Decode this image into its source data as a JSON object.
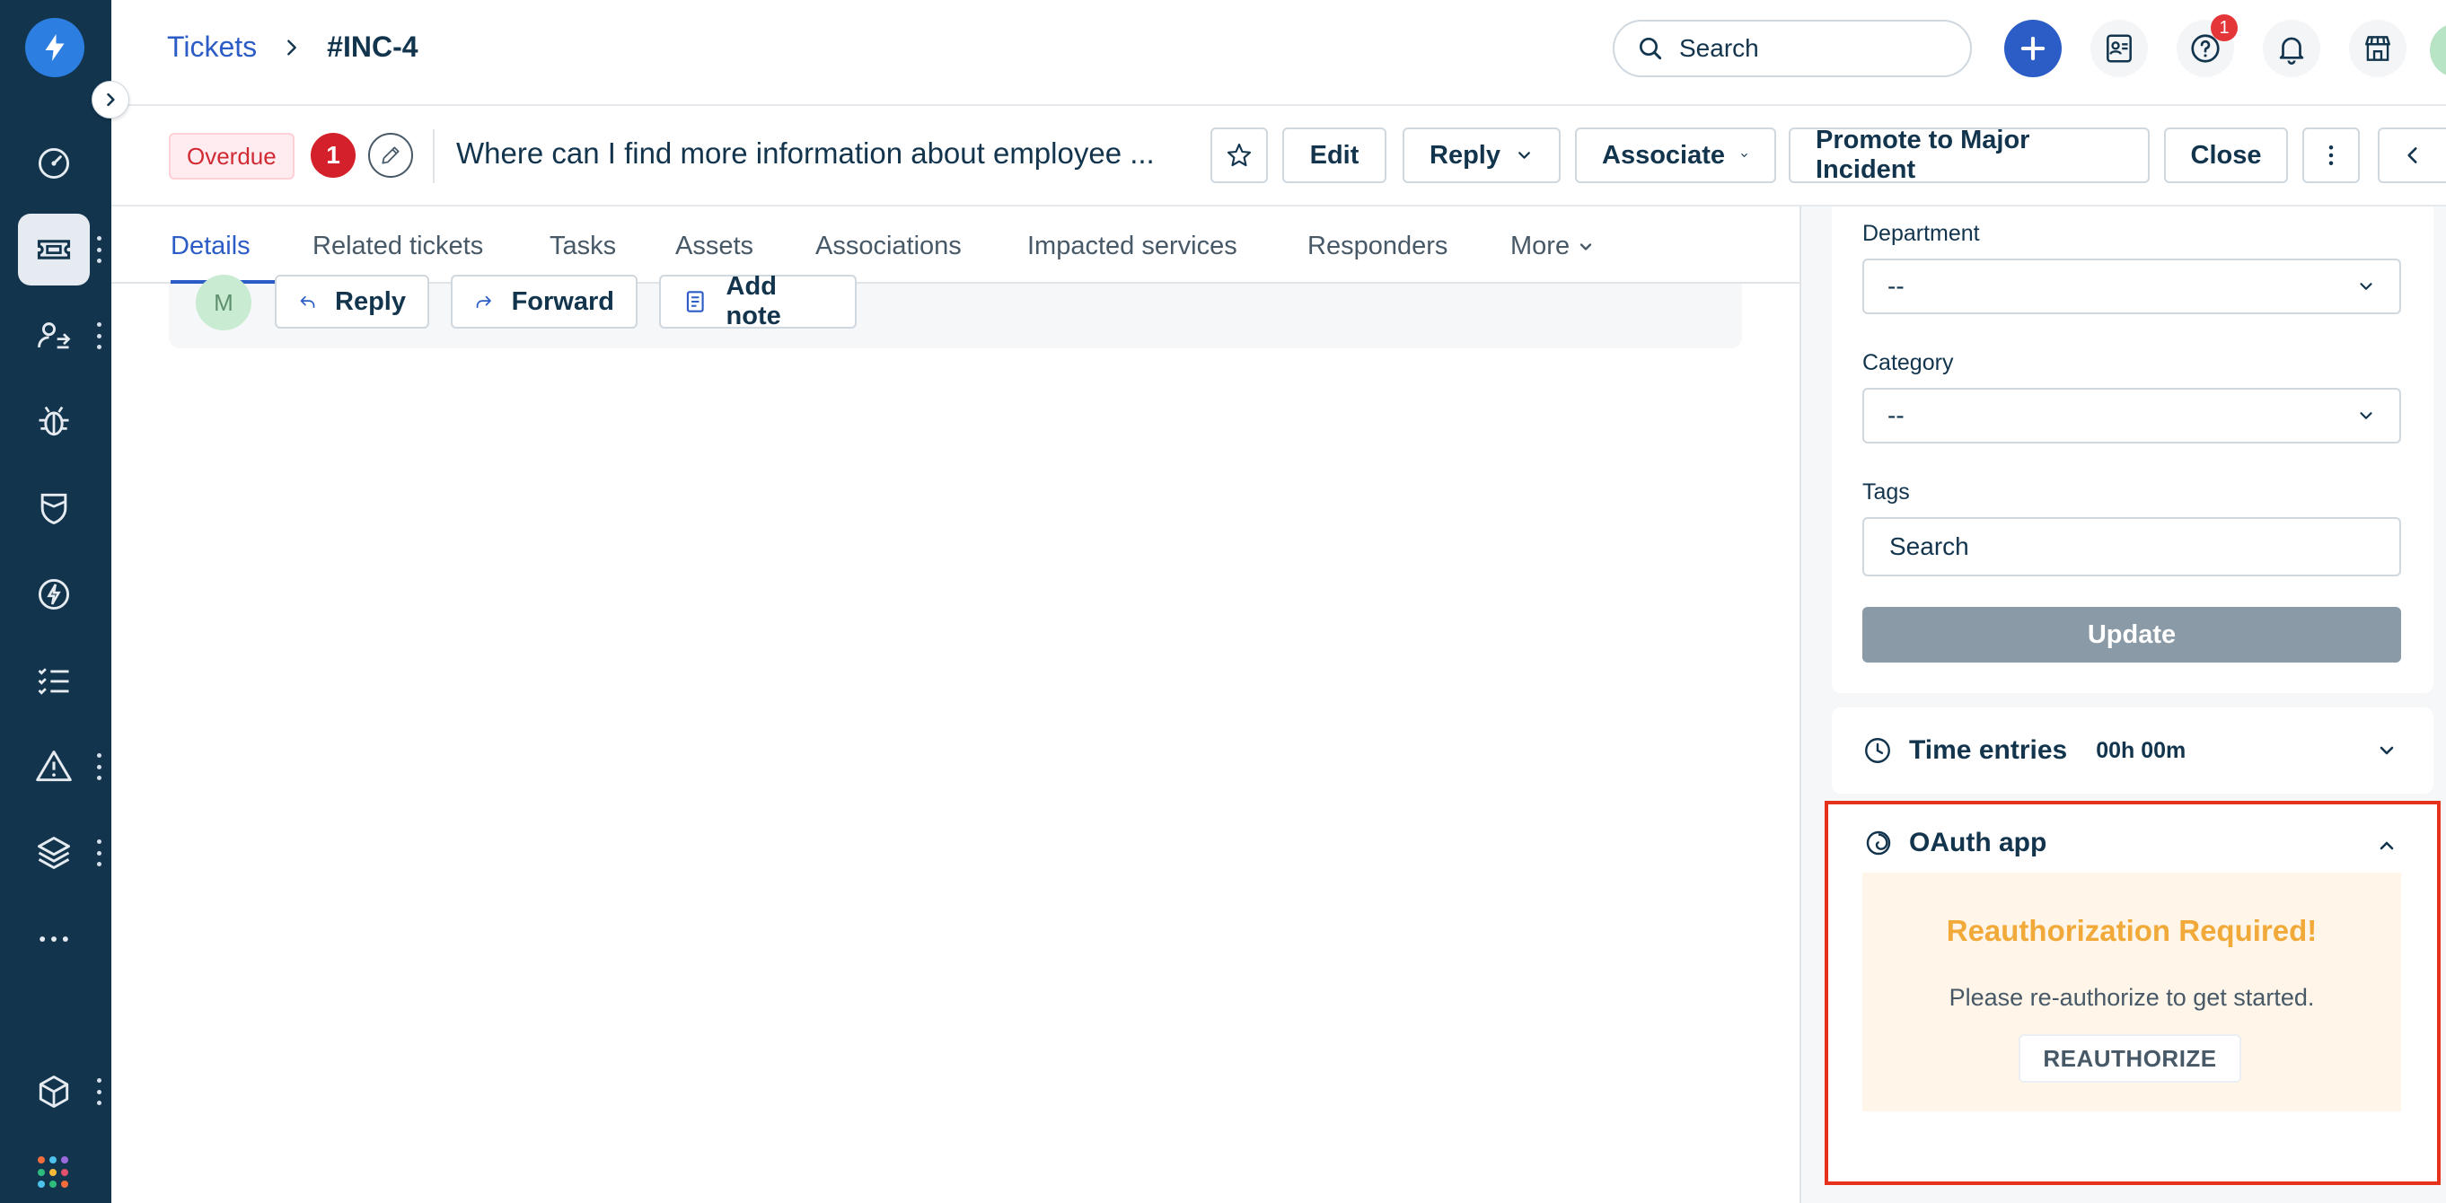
{
  "header": {
    "breadcrumb_root": "Tickets",
    "ticket_id": "#INC-4",
    "search_label": "Search",
    "help_badge": "1"
  },
  "ticket": {
    "status_badge": "Overdue",
    "priority_count": "1",
    "subject": "Where can I find more information about employee ...",
    "buttons": {
      "edit": "Edit",
      "reply": "Reply",
      "associate": "Associate",
      "promote": "Promote to Major Incident",
      "close": "Close"
    }
  },
  "tabs": [
    {
      "label": "Details"
    },
    {
      "label": "Related tickets"
    },
    {
      "label": "Tasks"
    },
    {
      "label": "Assets"
    },
    {
      "label": "Associations"
    },
    {
      "label": "Impacted services"
    },
    {
      "label": "Responders"
    },
    {
      "label": "More"
    }
  ],
  "conversation": {
    "avatar_initial": "M",
    "actions": {
      "reply": "Reply",
      "forward": "Forward",
      "add_note": "Add note"
    }
  },
  "properties": {
    "department": {
      "label": "Department",
      "value": "--"
    },
    "category": {
      "label": "Category",
      "value": "--"
    },
    "tags": {
      "label": "Tags",
      "placeholder": "Search"
    },
    "update_label": "Update"
  },
  "time_entries": {
    "title": "Time entries",
    "value": "00h 00m"
  },
  "oauth_app": {
    "title": "OAuth app",
    "reauth_title": "Reauthorization Required!",
    "reauth_text": "Please re-authorize to get started.",
    "reauth_button": "REAUTHORIZE"
  },
  "colors": {
    "nav_bg": "#12344d",
    "primary": "#2c5cc5",
    "overdue_red": "#d12a33",
    "warning_orange": "#f1a93a",
    "highlight_border": "#e6321c"
  }
}
